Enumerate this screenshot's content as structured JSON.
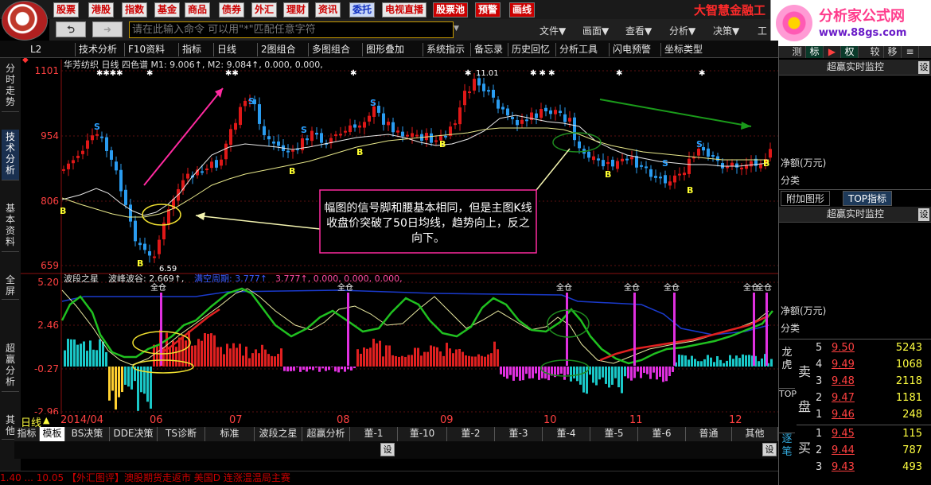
{
  "top_menu": {
    "buttons": [
      "股票",
      "港股",
      "指数",
      "基金",
      "商品",
      "债券",
      "外汇",
      "理财",
      "资讯",
      "委托",
      "电视直播",
      "股票池",
      "预警",
      "画线"
    ],
    "brand": "大智慧金融工",
    "site_name": "分析家公式网",
    "site_url": "www.88gs.com"
  },
  "command": {
    "placeholder": "请在此输入命令 可以用\"*\"匹配任意字符",
    "menus": [
      "文件▼",
      "画面▼",
      "查看▼",
      "分析▼",
      "决策▼",
      "工"
    ]
  },
  "toolbar": {
    "code": "L2",
    "items": [
      "技术分析",
      "F10资料",
      "指标",
      "日线",
      "2图组合",
      "多图组合",
      "图形叠加",
      "系统指示",
      "备忘录",
      "历史回忆",
      "分析工具",
      "闪电预警",
      "坐标类型"
    ]
  },
  "left_tabs": [
    "分时走势",
    "技术分析",
    "基本资料",
    "全屏",
    "超赢分析",
    "其他"
  ],
  "main_chart": {
    "info": "华芳纺织 日线 四色谱 M1: 9.006↑, M2: 9.084↑, 0.000, 0.000,",
    "price_labels": [
      "1101",
      "954",
      "806",
      "659"
    ],
    "low_label": "6.59",
    "high_label": "11.01",
    "annotation": "幅图的信号脚和腰基本相同，但是主图K线收盘价突破了50日均线，趋势向上，反之向下。"
  },
  "sub_chart": {
    "info_name": "波段之星",
    "info_rest": "波峰波谷: 2.669↑,",
    "info_blue": "满空周期: 3.777↑",
    "info_tail": "3.777↑, 0.000, 0.000, 0.000,",
    "price_labels": [
      "5.20",
      "2.46",
      "-0.27",
      "-2.96"
    ],
    "signal_label": "全仓"
  },
  "x_axis": {
    "period": "日线",
    "labels": [
      "2014/04",
      "06",
      "07",
      "08",
      "09",
      "10",
      "11",
      "12"
    ]
  },
  "bottom_tabs": [
    "指标",
    "模板",
    "BS决策",
    "DDE决策",
    "TS诊断",
    "标准",
    "波段之星",
    "超赢分析",
    "董-1",
    "董-10",
    "董-2",
    "董-3",
    "董-4",
    "董-5",
    "董-6",
    "普通",
    "其他"
  ],
  "settings_label": "设",
  "ticker": "1.40 ... 10.05 【外汇图评】澳股期货走返市 美国D 连涨温温局主赛",
  "right_panel": {
    "tabs": [
      "测",
      "标",
      "▶",
      "权",
      "较",
      "移",
      "≡"
    ],
    "panel1_title": "超赢实时监控",
    "net_label": "净额(万元)",
    "category_label": "分类",
    "sub_tabs": [
      "附加图形",
      "TOP指标"
    ],
    "panel2_title": "超赢实时监控",
    "side_labels": [
      "龙虎",
      "TOP",
      "逐笔"
    ],
    "sell_label": "卖盘",
    "buy_label": "买",
    "sell": [
      {
        "level": "5",
        "price": "9.50",
        "volume": "5243"
      },
      {
        "level": "4",
        "price": "9.49",
        "volume": "1068"
      },
      {
        "level": "3",
        "price": "9.48",
        "volume": "2118"
      },
      {
        "level": "2",
        "price": "9.47",
        "volume": "1181"
      },
      {
        "level": "1",
        "price": "9.46",
        "volume": "248"
      }
    ],
    "buy": [
      {
        "level": "1",
        "price": "9.45",
        "volume": "115"
      },
      {
        "level": "2",
        "price": "9.44",
        "volume": "787"
      },
      {
        "level": "3",
        "price": "9.43",
        "volume": "493"
      }
    ]
  }
}
